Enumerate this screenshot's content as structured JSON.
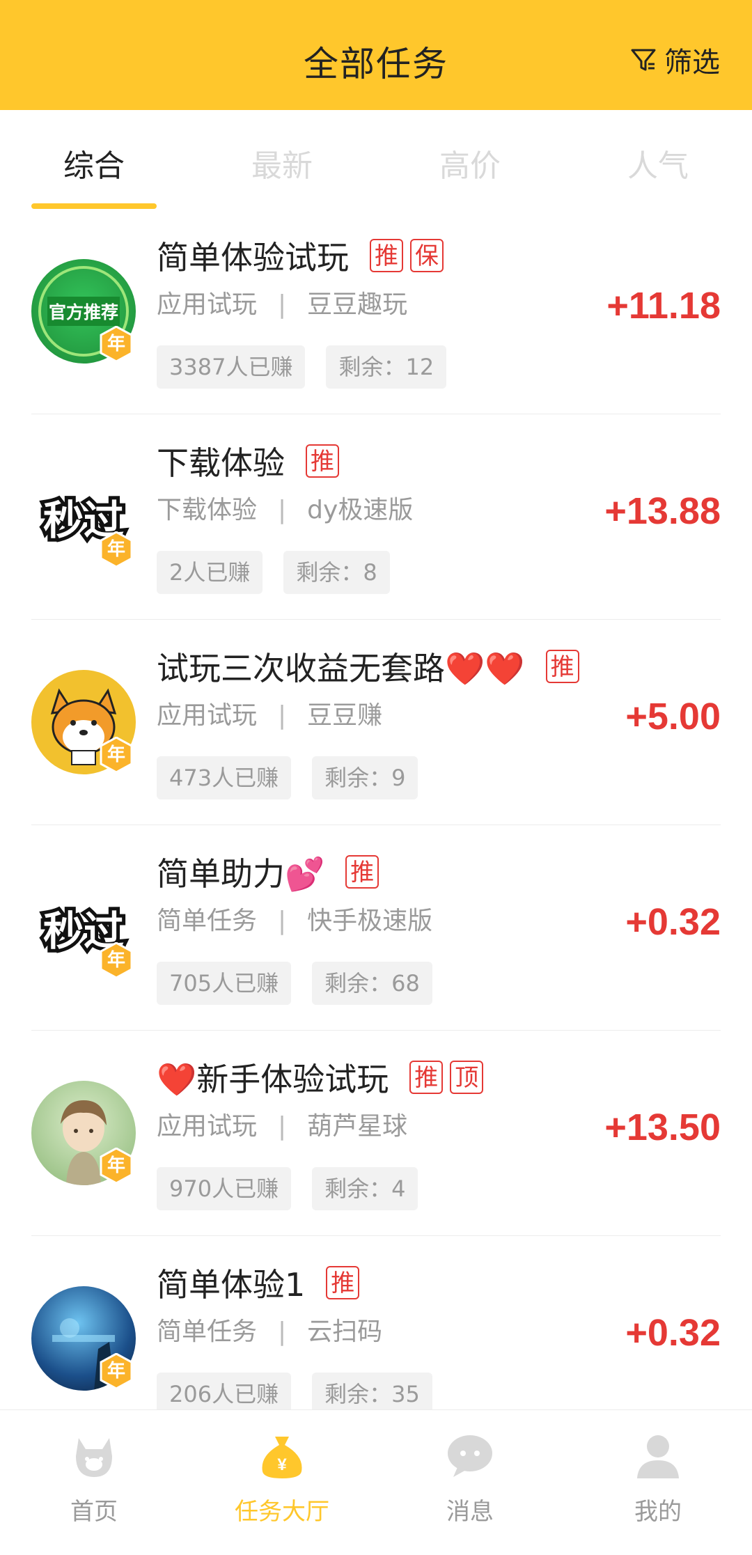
{
  "header": {
    "title": "全部任务",
    "filter_label": "筛选"
  },
  "tabs": [
    {
      "label": "综合",
      "active": true
    },
    {
      "label": "最新",
      "active": false
    },
    {
      "label": "高价",
      "active": false
    },
    {
      "label": "人气",
      "active": false
    }
  ],
  "tasks": [
    {
      "title": "简单体验试玩",
      "tags": [
        "推",
        "保"
      ],
      "category": "应用试玩",
      "app": "豆豆趣玩",
      "earned": "3387人已赚",
      "remaining": "剩余：12",
      "price": "+11.18",
      "avatar_text": "官方推荐",
      "badge": "年"
    },
    {
      "title": "下载体验",
      "tags": [
        "推"
      ],
      "category": "下载体验",
      "app": "dy极速版",
      "earned": "2人已赚",
      "remaining": "剩余：8",
      "price": "+13.88",
      "avatar_text": "秒过",
      "badge": "年"
    },
    {
      "title": "试玩三次收益无套路❤️❤️",
      "tags": [
        "推"
      ],
      "category": "应用试玩",
      "app": "豆豆赚",
      "earned": "473人已赚",
      "remaining": "剩余：9",
      "price": "+5.00",
      "avatar_text": "",
      "badge": "年"
    },
    {
      "title": "简单助力💕",
      "tags": [
        "推"
      ],
      "category": "简单任务",
      "app": "快手极速版",
      "earned": "705人已赚",
      "remaining": "剩余：68",
      "price": "+0.32",
      "avatar_text": "秒过",
      "badge": "年"
    },
    {
      "title": "❤️新手体验试玩",
      "tags": [
        "推",
        "顶"
      ],
      "category": "应用试玩",
      "app": "葫芦星球",
      "earned": "970人已赚",
      "remaining": "剩余：4",
      "price": "+13.50",
      "avatar_text": "",
      "badge": "年"
    },
    {
      "title": "简单体验1",
      "tags": [
        "推"
      ],
      "category": "简单任务",
      "app": "云扫码",
      "earned": "206人已赚",
      "remaining": "剩余：35",
      "price": "+0.32",
      "avatar_text": "",
      "badge": "年"
    }
  ],
  "bottom_nav": [
    {
      "label": "首页",
      "icon": "bunny-home-icon",
      "active": false
    },
    {
      "label": "任务大厅",
      "icon": "money-bag-icon",
      "active": true
    },
    {
      "label": "消息",
      "icon": "chat-bubble-icon",
      "active": false
    },
    {
      "label": "我的",
      "icon": "user-icon",
      "active": false
    }
  ],
  "colors": {
    "accent": "#ffc72c",
    "price": "#e53935",
    "muted": "#9a9a9a"
  }
}
